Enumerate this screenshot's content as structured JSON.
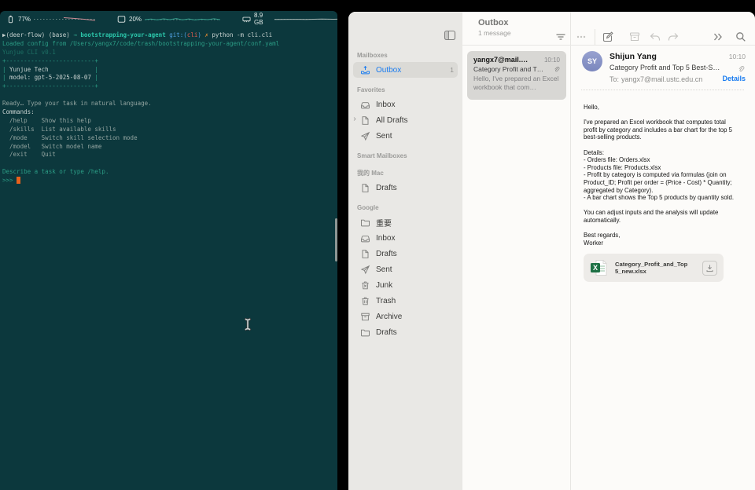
{
  "colors": {
    "accent_blue": "#1a7cf0",
    "terminal_bg": "#0c383d",
    "cursor_orange": "#e8611c",
    "excel_green": "#1e7145"
  },
  "terminal": {
    "statusbar": {
      "battery": {
        "icon": "battery-icon",
        "label": "77%"
      },
      "cpu": {
        "icon": "cpu-icon",
        "label": "20%"
      },
      "memory": {
        "icon": "memory-icon",
        "label": "8.9 GB"
      }
    },
    "lines": [
      [
        {
          "t": "▶",
          "c": "fg"
        },
        {
          "t": "(deer-flow) (base) ",
          "c": "fg"
        },
        {
          "t": "→ ",
          "c": "green"
        },
        {
          "t": "bootstrapping-your-agent ",
          "c": "cyan"
        },
        {
          "t": "git:(",
          "c": "blue"
        },
        {
          "t": "cli",
          "c": "red"
        },
        {
          "t": ") ",
          "c": "blue"
        },
        {
          "t": "✗ ",
          "c": "orange"
        },
        {
          "t": "python -m cli.cli",
          "c": "fg"
        }
      ],
      [
        {
          "t": "Loaded config from /Users/yangx7/code/trash/bootstrapping-your-agent/conf.yaml",
          "c": "teal"
        }
      ],
      [
        {
          "t": "Yunjue CLI v0.1",
          "c": "dimteal"
        }
      ],
      [
        {
          "t": "+-------------------------+",
          "c": "teal"
        }
      ],
      [
        {
          "t": "| ",
          "c": "teal"
        },
        {
          "t": "Yunjue Tech",
          "c": "fg"
        },
        {
          "t": "             |",
          "c": "teal"
        }
      ],
      [
        {
          "t": "| ",
          "c": "teal"
        },
        {
          "t": "model: gpt-5-2025-08-07",
          "c": "fg"
        },
        {
          "t": " |",
          "c": "teal"
        }
      ],
      [
        {
          "t": "+-------------------------+",
          "c": "teal"
        }
      ],
      [],
      [
        {
          "t": "Ready… Type your task in natural language.",
          "c": "muted"
        }
      ],
      [
        {
          "t": "Commands:",
          "c": "fg"
        }
      ],
      [
        {
          "t": "  /help    Show this help",
          "c": "muted"
        }
      ],
      [
        {
          "t": "  /skills  List available skills",
          "c": "muted"
        }
      ],
      [
        {
          "t": "  /mode    Switch skill selection mode",
          "c": "muted"
        }
      ],
      [
        {
          "t": "  /model   Switch model name",
          "c": "muted"
        }
      ],
      [
        {
          "t": "  /exit    Quit",
          "c": "muted"
        }
      ],
      [],
      [
        {
          "t": "Describe a task or type /help.",
          "c": "teal"
        }
      ],
      [
        {
          "t": ">>> ",
          "c": "teal"
        },
        {
          "t": " ",
          "c": "cursor"
        }
      ]
    ]
  },
  "mail": {
    "toolbar": {
      "title": "Outbox",
      "subtitle": "1 message",
      "icons": [
        "sidebar-toggle-icon",
        "filter-icon",
        "more-icon",
        "compose-icon",
        "archive-icon",
        "reply-icon",
        "forward-icon",
        "double-chevron-icon",
        "search-icon"
      ]
    },
    "sidebar": {
      "sections": [
        {
          "header": "Mailboxes",
          "items": [
            {
              "icon": "outbox-icon",
              "label": "Outbox",
              "selected": true,
              "count": "1"
            }
          ]
        },
        {
          "header": "Favorites",
          "items": [
            {
              "icon": "inbox-icon",
              "label": "Inbox"
            },
            {
              "icon": "drafts-icon",
              "label": "All Drafts",
              "chevron": "›"
            },
            {
              "icon": "sent-icon",
              "label": "Sent"
            }
          ]
        },
        {
          "header": "Smart Mailboxes",
          "items": []
        },
        {
          "header": "我的 Mac",
          "items": [
            {
              "icon": "drafts-icon",
              "label": "Drafts"
            }
          ]
        },
        {
          "header": "Google",
          "items": [
            {
              "icon": "folder-icon",
              "label": "重要"
            },
            {
              "icon": "inbox-icon",
              "label": "Inbox"
            },
            {
              "icon": "drafts-icon",
              "label": "Drafts"
            },
            {
              "icon": "sent-icon",
              "label": "Sent"
            },
            {
              "icon": "junk-icon",
              "label": "Junk"
            },
            {
              "icon": "trash-icon",
              "label": "Trash"
            },
            {
              "icon": "archive-box-icon",
              "label": "Archive"
            },
            {
              "icon": "folder-icon",
              "label": "Drafts"
            }
          ]
        }
      ]
    },
    "message_list": {
      "items": [
        {
          "sender": "yangx7@mail.…",
          "time": "10:10",
          "subject": "Category Profit and T…",
          "preview": "Hello, I've prepared an Excel workbook that com…",
          "selected": true,
          "attachment": true
        }
      ]
    },
    "detail": {
      "avatar_initials": "SY",
      "sender": "Shijun Yang",
      "time": "10:10",
      "subject": "Category Profit and Top 5 Best-S…",
      "to_label": "To:",
      "to_address": "yangx7@mail.ustc.edu.cn",
      "details_link": "Details",
      "body": [
        "Hello,",
        "",
        "I've prepared an Excel workbook that computes total profit by category and includes a bar chart for the top 5 best-selling products.",
        "",
        "Details:",
        "- Orders file: Orders.xlsx",
        "- Products file: Products.xlsx",
        "- Profit by category is computed via formulas (join on Product_ID; Profit per order = (Price - Cost) * Quantity; aggregated by Category).",
        "- A bar chart shows the Top 5 products by quantity sold.",
        "",
        "You can adjust inputs and the analysis will update automatically.",
        "",
        "Best regards,",
        "Worker"
      ],
      "attachment": {
        "filename": "Category_Profit_and_Top5_new.xlsx",
        "type": "xlsx"
      }
    }
  }
}
